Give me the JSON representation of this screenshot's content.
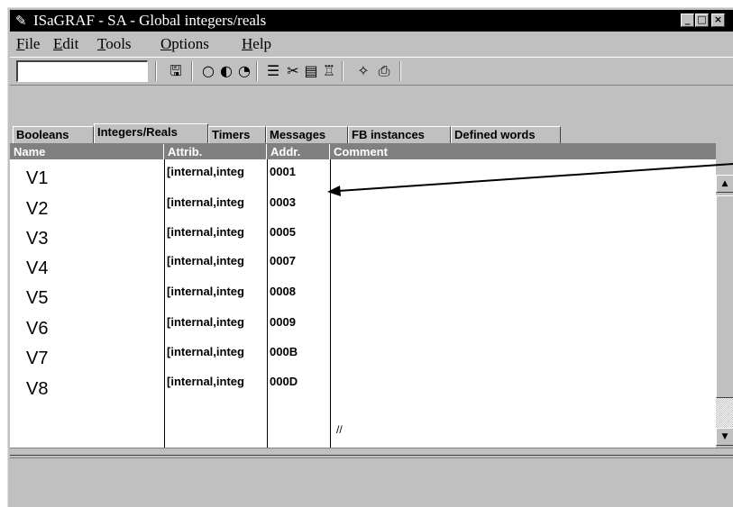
{
  "window": {
    "title": "ISaGRAF - SA - Global integers/reals",
    "app_icon": "isagraf-pen-icon",
    "buttons": [
      "minimize-icon",
      "maximize-icon",
      "close-icon"
    ]
  },
  "menu": {
    "items": [
      {
        "hotkey": "F",
        "rest": "ile"
      },
      {
        "hotkey": "E",
        "rest": "dit"
      },
      {
        "hotkey": "T",
        "rest": "ools"
      },
      {
        "hotkey": "O",
        "rest": "ptions"
      },
      {
        "hotkey": "H",
        "rest": "elp"
      }
    ]
  },
  "toolbar": {
    "input_value": "",
    "icons": [
      "save-icon",
      "circle-open-icon",
      "circle-half-icon",
      "circle-clock-icon",
      "list-icon",
      "cut-icon",
      "copy-icon",
      "paste-icon",
      "magic-wand-icon",
      "print-icon"
    ]
  },
  "tabs": [
    {
      "label": "Booleans",
      "active": false
    },
    {
      "label": "Integers/Reals",
      "active": true
    },
    {
      "label": "Timers",
      "active": false
    },
    {
      "label": "Messages",
      "active": false
    },
    {
      "label": "FB instances",
      "active": false
    },
    {
      "label": "Defined words",
      "active": false
    }
  ],
  "table": {
    "headers": {
      "name": "Name",
      "attrib": "Attrib.",
      "addr": "Addr.",
      "comment": "Comment"
    },
    "rows": [
      {
        "name": "V1",
        "attrib": "[internal,integ",
        "addr": "0001",
        "comment": ""
      },
      {
        "name": "V2",
        "attrib": "[internal,integ",
        "addr": "0003",
        "comment": ""
      },
      {
        "name": "V3",
        "attrib": "[internal,integ",
        "addr": "0005",
        "comment": ""
      },
      {
        "name": "V4",
        "attrib": "[internal,integ",
        "addr": "0007",
        "comment": ""
      },
      {
        "name": "V5",
        "attrib": "[internal,integ",
        "addr": "0008",
        "comment": ""
      },
      {
        "name": "V6",
        "attrib": "[internal,integ",
        "addr": "0009",
        "comment": ""
      },
      {
        "name": "V7",
        "attrib": "[internal,integ",
        "addr": "000B",
        "comment": ""
      },
      {
        "name": "V8",
        "attrib": "[internal,integ",
        "addr": "000D",
        "comment": ""
      }
    ],
    "last_comment": "//"
  },
  "status": {
    "text": ""
  },
  "colors": {
    "titlebar": "#000000",
    "window": "#c0c0c0",
    "header": "#808080",
    "grid": "#ffffff"
  }
}
